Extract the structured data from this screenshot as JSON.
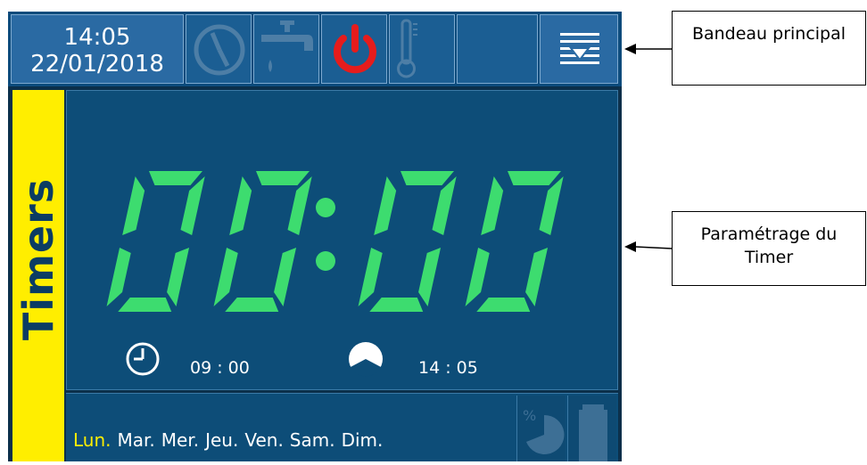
{
  "header": {
    "time": "14:05",
    "date": "22/01/2018",
    "icons": [
      "clock-icon",
      "faucet-icon",
      "power-icon",
      "thermometer-icon",
      "menu-icon"
    ]
  },
  "sidebar": {
    "label": "Timers"
  },
  "timer": {
    "display": "00:00",
    "start_time": "09 : 00",
    "end_time": "14 : 05"
  },
  "days": [
    {
      "label": "Lun.",
      "selected": true
    },
    {
      "label": "Mar.",
      "selected": false
    },
    {
      "label": "Mer.",
      "selected": false
    },
    {
      "label": "Jeu.",
      "selected": false
    },
    {
      "label": "Ven.",
      "selected": false
    },
    {
      "label": "Sam.",
      "selected": false
    },
    {
      "label": "Dim.",
      "selected": false
    }
  ],
  "callouts": {
    "header": "Bandeau principal",
    "timer": "Paramétrage du Timer"
  },
  "colors": {
    "digit": "#3ddc6f",
    "power": "#e61c1c",
    "accent": "#ffee00"
  }
}
